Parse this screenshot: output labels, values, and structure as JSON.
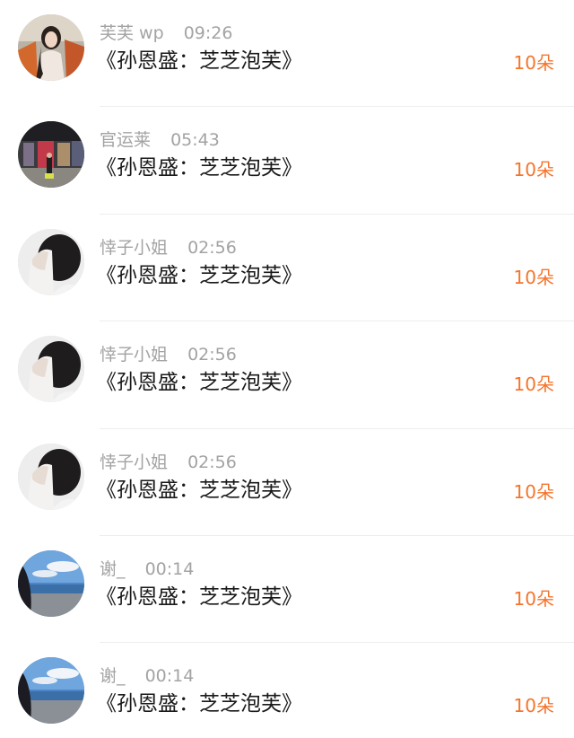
{
  "gift_list": {
    "items": [
      {
        "name": "芙芙 wp",
        "time": "09:26",
        "title": "《孙恩盛：芝芝泡芙》",
        "count": "10朵",
        "avatar": "avatar-woman-car"
      },
      {
        "name": "官运莱",
        "time": "05:43",
        "title": "《孙恩盛：芝芝泡芙》",
        "count": "10朵",
        "avatar": "avatar-mall"
      },
      {
        "name": "悻子小姐",
        "time": "02:56",
        "title": "《孙恩盛：芝芝泡芙》",
        "count": "10朵",
        "avatar": "avatar-hand-face"
      },
      {
        "name": "悻子小姐",
        "time": "02:56",
        "title": "《孙恩盛：芝芝泡芙》",
        "count": "10朵",
        "avatar": "avatar-hand-face"
      },
      {
        "name": "悻子小姐",
        "time": "02:56",
        "title": "《孙恩盛：芝芝泡芙》",
        "count": "10朵",
        "avatar": "avatar-hand-face"
      },
      {
        "name": "谢_",
        "time": "00:14",
        "title": "《孙恩盛：芝芝泡芙》",
        "count": "10朵",
        "avatar": "avatar-sea"
      },
      {
        "name": "谢_",
        "time": "00:14",
        "title": "《孙恩盛：芝芝泡芙》",
        "count": "10朵",
        "avatar": "avatar-sea"
      }
    ]
  },
  "colors": {
    "accent": "#f5742b",
    "meta_text": "#a3a3a3",
    "title_text": "#1a1a1a",
    "divider": "#ededed"
  }
}
